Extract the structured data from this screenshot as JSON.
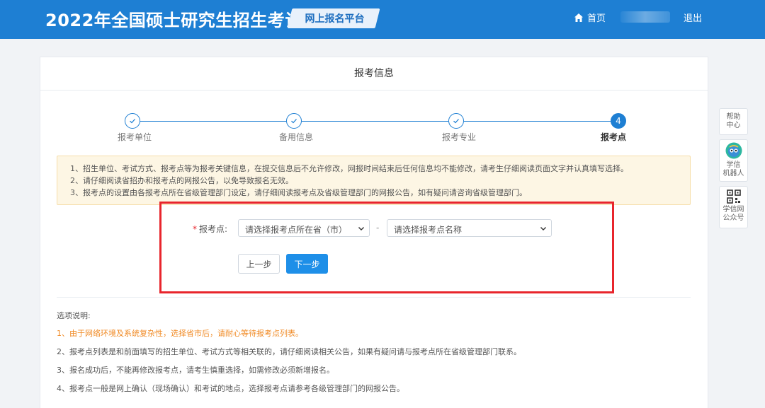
{
  "header": {
    "site_title": "2022年全国硕士研究生招生考试",
    "platform": "网上报名平台",
    "nav_home": "首页",
    "nav_logout": "退出"
  },
  "card": {
    "title": "报考信息"
  },
  "steps": [
    {
      "label": "报考单位",
      "state": "done",
      "icon": "check-icon"
    },
    {
      "label": "备用信息",
      "state": "done",
      "icon": "check-icon"
    },
    {
      "label": "报考专业",
      "state": "done",
      "icon": "check-icon"
    },
    {
      "label": "报考点",
      "state": "current",
      "number": "4"
    }
  ],
  "notice": [
    "1、招生单位、考试方式、报考点等为报考关键信息，在提交信息后不允许修改，网报时间结束后任何信息均不能修改，请考生仔细阅读页面文字并认真填写选择。",
    "2、请仔细阅读省招办和报考点的网报公告，以免导致报名无效。",
    "3、报考点的设置由各报考点所在省级管理部门设定，请仔细阅读报考点及省级管理部门的网报公告，如有疑问请咨询省级管理部门。"
  ],
  "form": {
    "required_mark": "*",
    "label": "报考点:",
    "province_select": "请选择报考点所在省（市）",
    "separator": "-",
    "site_select": "请选择报考点名称",
    "prev_button": "上一步",
    "next_button": "下一步"
  },
  "explanation": {
    "title": "选项说明:",
    "items": [
      "1、由于网络环境及系统复杂性，选择省市后，请耐心等待报考点列表。",
      "2、报考点列表是和前面填写的招生单位、考试方式等相关联的，请仔细阅读相关公告，如果有疑问请与报考点所在省级管理部门联系。",
      "3、报名成功后，不能再修改报考点，请考生慎重选择，如需修改必须新增报名。",
      "4、报考点一般是网上确认（现场确认）和考试的地点，选择报考点请参考各级管理部门的网报公告。"
    ]
  },
  "side": {
    "help_line1": "帮助",
    "help_line2": "中心",
    "robot_line1": "学信",
    "robot_line2": "机器人",
    "wechat_line1": "学信网",
    "wechat_line2": "公众号"
  },
  "colors": {
    "header_bg": "#1e7fd3",
    "accent": "#1e8fe8",
    "highlight_border": "#e8252c",
    "notice_bg": "#fdf6e4",
    "warning_text": "#f08a24"
  }
}
